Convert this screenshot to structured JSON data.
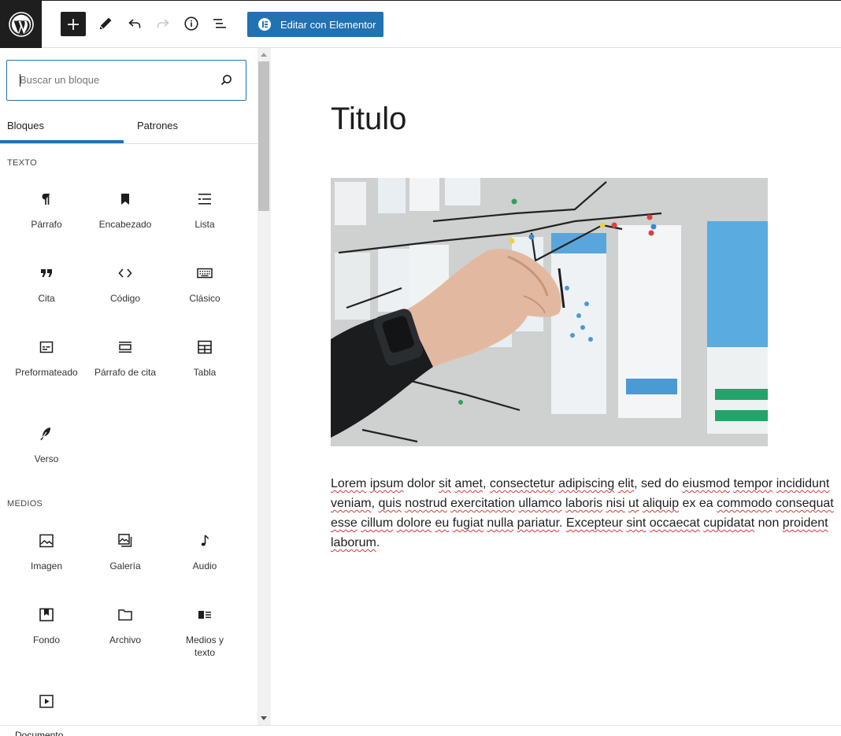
{
  "toolbar": {
    "elementor_label": "Editar con Elementor",
    "icons": [
      "wordpress-logo",
      "plus-icon",
      "pencil-icon",
      "undo-icon",
      "redo-icon",
      "info-icon",
      "list-view-icon"
    ]
  },
  "inserter": {
    "search_placeholder": "Buscar un bloque",
    "tabs": [
      "Bloques",
      "Patrones"
    ],
    "categories": [
      {
        "title": "TEXTO",
        "blocks": [
          {
            "label": "Párrafo",
            "icon": "paragraph-icon"
          },
          {
            "label": "Encabezado",
            "icon": "bookmark-icon"
          },
          {
            "label": "Lista",
            "icon": "list-icon"
          },
          {
            "label": "Cita",
            "icon": "quote-icon"
          },
          {
            "label": "Código",
            "icon": "code-icon"
          },
          {
            "label": "Clásico",
            "icon": "keyboard-icon"
          },
          {
            "label": "Preformateado",
            "icon": "preformatted-icon"
          },
          {
            "label": "Párrafo de cita",
            "icon": "pullquote-icon"
          },
          {
            "label": "Tabla",
            "icon": "table-icon"
          },
          {
            "label": "Verso",
            "icon": "feather-icon"
          }
        ]
      },
      {
        "title": "MEDIOS",
        "blocks": [
          {
            "label": "Imagen",
            "icon": "image-icon"
          },
          {
            "label": "Galería",
            "icon": "gallery-icon"
          },
          {
            "label": "Audio",
            "icon": "music-note-icon"
          },
          {
            "label": "Fondo",
            "icon": "cover-icon"
          },
          {
            "label": "Archivo",
            "icon": "folder-icon"
          },
          {
            "label": "Medios y texto",
            "icon": "media-text-icon"
          },
          {
            "label": "",
            "icon": "video-icon"
          }
        ]
      }
    ]
  },
  "footer": {
    "breadcrumb": "Documento"
  },
  "post": {
    "title": "Titulo",
    "paragraph_lines": [
      [
        [
          "Lorem",
          1
        ],
        " ",
        [
          "ipsum",
          1
        ],
        " dolor ",
        [
          "sit",
          1
        ],
        " ",
        [
          "amet",
          1
        ],
        ", ",
        [
          "consectetur",
          1
        ],
        " ",
        [
          "adipiscing",
          1
        ],
        " ",
        [
          "elit",
          1
        ],
        ", sed do ",
        [
          "eiusmod",
          1
        ],
        " ",
        [
          "tempor",
          1
        ],
        " ",
        [
          "incididunt",
          1
        ]
      ],
      [
        [
          "veniam",
          1
        ],
        ", ",
        [
          "quis",
          1
        ],
        " ",
        [
          "nostrud",
          1
        ],
        " ",
        [
          "exercitation",
          1
        ],
        " ",
        [
          "ullamco",
          1
        ],
        " ",
        [
          "laboris",
          1
        ],
        " ",
        [
          "nisi",
          1
        ],
        " ",
        [
          "ut",
          1
        ],
        " ",
        [
          "aliquip",
          1
        ],
        " ex ea ",
        [
          "commodo",
          1
        ],
        " ",
        [
          "consequat",
          1
        ]
      ],
      [
        [
          "esse",
          1
        ],
        " ",
        [
          "cillum",
          1
        ],
        " ",
        [
          "dolore",
          1
        ],
        " ",
        [
          "eu",
          1
        ],
        " ",
        [
          "fugiat",
          1
        ],
        " ",
        [
          "nulla",
          1
        ],
        " ",
        [
          "pariatur",
          1
        ],
        ". ",
        [
          "Excepteur",
          1
        ],
        " ",
        [
          "sint",
          1
        ],
        " ",
        [
          "occaecat",
          1
        ],
        " ",
        [
          "cupidatat",
          1
        ],
        " non ",
        [
          "proident",
          1
        ]
      ],
      [
        [
          "laborum",
          1
        ],
        "."
      ]
    ]
  }
}
